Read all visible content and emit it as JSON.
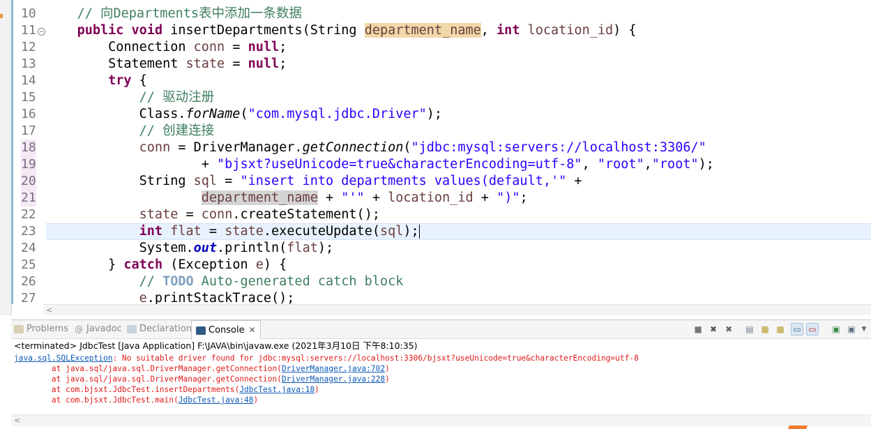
{
  "editor": {
    "line_numbers": [
      "10",
      "11",
      "12",
      "13",
      "14",
      "15",
      "16",
      "17",
      "18",
      "19",
      "20",
      "21",
      "22",
      "23",
      "24",
      "25",
      "26",
      "27"
    ],
    "highlighted_lines": [
      "18",
      "19",
      "20",
      "21"
    ],
    "lines": [
      [
        {
          "t": "    ",
          "c": ""
        },
        {
          "t": "// 向Departments表中添加一条数据",
          "c": "cm"
        }
      ],
      [
        {
          "t": "    ",
          "c": ""
        },
        {
          "t": "public",
          "c": "kw"
        },
        {
          "t": " ",
          "c": ""
        },
        {
          "t": "void",
          "c": "kw"
        },
        {
          "t": " insertDepartments(String ",
          "c": ""
        },
        {
          "t": "department_name",
          "c": "var occ"
        },
        {
          "t": ", ",
          "c": ""
        },
        {
          "t": "int",
          "c": "kw"
        },
        {
          "t": " ",
          "c": ""
        },
        {
          "t": "location_id",
          "c": "var"
        },
        {
          "t": ") {",
          "c": ""
        }
      ],
      [
        {
          "t": "        Connection ",
          "c": ""
        },
        {
          "t": "conn",
          "c": "var"
        },
        {
          "t": " = ",
          "c": ""
        },
        {
          "t": "null",
          "c": "kw"
        },
        {
          "t": ";",
          "c": ""
        }
      ],
      [
        {
          "t": "        Statement ",
          "c": ""
        },
        {
          "t": "state",
          "c": "var"
        },
        {
          "t": " = ",
          "c": ""
        },
        {
          "t": "null",
          "c": "kw"
        },
        {
          "t": ";",
          "c": ""
        }
      ],
      [
        {
          "t": "        ",
          "c": ""
        },
        {
          "t": "try",
          "c": "kw"
        },
        {
          "t": " {",
          "c": ""
        }
      ],
      [
        {
          "t": "            ",
          "c": ""
        },
        {
          "t": "// 驱动注册",
          "c": "cm"
        }
      ],
      [
        {
          "t": "            Class.",
          "c": ""
        },
        {
          "t": "forName",
          "c": "it"
        },
        {
          "t": "(",
          "c": ""
        },
        {
          "t": "\"com.mysql.jdbc.Driver\"",
          "c": "str"
        },
        {
          "t": ");",
          "c": ""
        }
      ],
      [
        {
          "t": "            ",
          "c": ""
        },
        {
          "t": "// 创建连接",
          "c": "cm"
        }
      ],
      [
        {
          "t": "            ",
          "c": ""
        },
        {
          "t": "conn",
          "c": "var"
        },
        {
          "t": " = DriverManager.",
          "c": ""
        },
        {
          "t": "getConnection",
          "c": "it"
        },
        {
          "t": "(",
          "c": ""
        },
        {
          "t": "\"jdbc:mysql:servers://localhost:3306/\"",
          "c": "str"
        }
      ],
      [
        {
          "t": "                    + ",
          "c": ""
        },
        {
          "t": "\"bjsxt?useUnicode=true&characterEncoding=utf-8\"",
          "c": "str"
        },
        {
          "t": ", ",
          "c": ""
        },
        {
          "t": "\"root\"",
          "c": "str"
        },
        {
          "t": ",",
          "c": ""
        },
        {
          "t": "\"root\"",
          "c": "str"
        },
        {
          "t": ");",
          "c": ""
        }
      ],
      [
        {
          "t": "            String ",
          "c": ""
        },
        {
          "t": "sql",
          "c": "var"
        },
        {
          "t": " = ",
          "c": ""
        },
        {
          "t": "\"insert into departments values(default,'\"",
          "c": "str"
        },
        {
          "t": " +",
          "c": ""
        }
      ],
      [
        {
          "t": "                    ",
          "c": ""
        },
        {
          "t": "department_name",
          "c": "var occ2"
        },
        {
          "t": " + ",
          "c": ""
        },
        {
          "t": "\"'\"",
          "c": "str"
        },
        {
          "t": " + ",
          "c": ""
        },
        {
          "t": "location_id",
          "c": "var"
        },
        {
          "t": " + ",
          "c": ""
        },
        {
          "t": "\")\"",
          "c": "str"
        },
        {
          "t": ";",
          "c": ""
        }
      ],
      [
        {
          "t": "            ",
          "c": ""
        },
        {
          "t": "state",
          "c": "var"
        },
        {
          "t": " = ",
          "c": ""
        },
        {
          "t": "conn",
          "c": "var"
        },
        {
          "t": ".createStatement();",
          "c": ""
        }
      ],
      [
        {
          "t": "            ",
          "c": ""
        },
        {
          "t": "int",
          "c": "kw"
        },
        {
          "t": " ",
          "c": ""
        },
        {
          "t": "flat",
          "c": "var"
        },
        {
          "t": " = ",
          "c": ""
        },
        {
          "t": "state",
          "c": "var"
        },
        {
          "t": ".executeUpdate(",
          "c": ""
        },
        {
          "t": "sql",
          "c": "var"
        },
        {
          "t": ");",
          "c": ""
        },
        {
          "t": "",
          "c": "caret"
        }
      ],
      [
        {
          "t": "            System.",
          "c": ""
        },
        {
          "t": "out",
          "c": "fld"
        },
        {
          "t": ".println(",
          "c": ""
        },
        {
          "t": "flat",
          "c": "var"
        },
        {
          "t": ");",
          "c": ""
        }
      ],
      [
        {
          "t": "        } ",
          "c": ""
        },
        {
          "t": "catch",
          "c": "kw"
        },
        {
          "t": " (Exception ",
          "c": ""
        },
        {
          "t": "e",
          "c": "var"
        },
        {
          "t": ") {",
          "c": ""
        }
      ],
      [
        {
          "t": "            ",
          "c": ""
        },
        {
          "t": "// ",
          "c": "cm"
        },
        {
          "t": "TODO",
          "c": "todo"
        },
        {
          "t": " Auto-generated catch block",
          "c": "cm"
        }
      ],
      [
        {
          "t": "            ",
          "c": ""
        },
        {
          "t": "e",
          "c": "var"
        },
        {
          "t": ".printStackTrace();",
          "c": ""
        }
      ]
    ],
    "current_line": "23"
  },
  "console_view": {
    "tabs": [
      {
        "label": "Problems",
        "icon": "problems-icon",
        "active": false
      },
      {
        "label": "Javadoc",
        "icon": "javadoc-icon",
        "active": false
      },
      {
        "label": "Declaration",
        "icon": "declaration-icon",
        "active": false
      },
      {
        "label": "Console",
        "icon": "console-icon",
        "active": true
      }
    ],
    "toolbar_icons": [
      "terminate-icon",
      "remove-launch-icon",
      "remove-all-terminated-icon",
      "clear-console-icon",
      "scroll-lock-icon",
      "word-wrap-icon",
      "show-on-stdout-icon",
      "show-on-stderr-icon",
      "pin-console-icon",
      "display-selected-console-icon",
      "open-console-icon",
      "view-menu-icon"
    ],
    "description": "<terminated> JdbcTest [Java Application] F:\\JAVA\\bin\\javaw.exe (2021年3月10日 下午8:10:35)",
    "output": [
      [
        {
          "t": "java.sql.SQLException",
          "c": "lnk"
        },
        {
          "t": ": No suitable driver found for jdbc:mysql:servers://localhost:3306/bjsxt?useUnicode=true&characterEncoding=utf-8",
          "c": ""
        }
      ],
      [
        {
          "t": "\tat java.sql/java.sql.DriverManager.getConnection(",
          "c": ""
        },
        {
          "t": "DriverManager.java:702",
          "c": "lnk"
        },
        {
          "t": ")",
          "c": ""
        }
      ],
      [
        {
          "t": "\tat java.sql/java.sql.DriverManager.getConnection(",
          "c": ""
        },
        {
          "t": "DriverManager.java:228",
          "c": "lnk"
        },
        {
          "t": ")",
          "c": ""
        }
      ],
      [
        {
          "t": "\tat com.bjsxt.JdbcTest.insertDepartments(",
          "c": ""
        },
        {
          "t": "JdbcTest.java:18",
          "c": "lnk"
        },
        {
          "t": ")",
          "c": ""
        }
      ],
      [
        {
          "t": "\tat com.bjsxt.JdbcTest.main(",
          "c": ""
        },
        {
          "t": "JdbcTest.java:48",
          "c": "lnk"
        },
        {
          "t": ")",
          "c": ""
        }
      ]
    ]
  },
  "colors": {
    "keyword": "#7f0055",
    "comment": "#3f7f5f",
    "string": "#2a00ff",
    "variable": "#6a3e3e",
    "error": "#e01b1b",
    "link": "#0b58b8"
  }
}
